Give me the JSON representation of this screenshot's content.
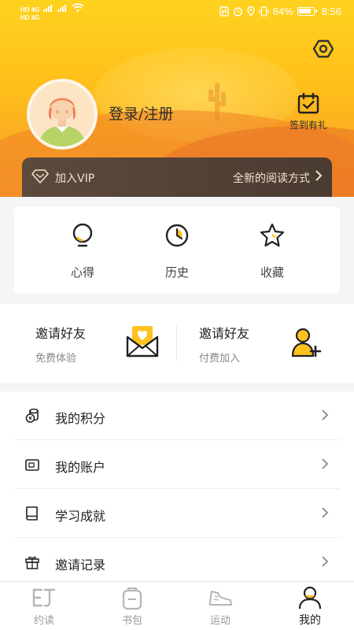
{
  "status_bar": {
    "left_top": "HD 4G",
    "left_bottom": "HD 4G",
    "battery": "84%",
    "time": "8:56"
  },
  "profile": {
    "login_label": "登录/注册",
    "checkin_label": "签到有礼"
  },
  "vip": {
    "join_label": "加入VIP",
    "tagline": "全新的阅读方式"
  },
  "quick_actions": [
    {
      "label": "心得",
      "icon": "lightbulb-icon"
    },
    {
      "label": "历史",
      "icon": "clock-icon"
    },
    {
      "label": "收藏",
      "icon": "star-icon"
    }
  ],
  "invite": {
    "free": {
      "title": "邀请好友",
      "subtitle": "免费体验"
    },
    "paid": {
      "title": "邀请好友",
      "subtitle": "付费加入"
    }
  },
  "menu": [
    {
      "label": "我的积分",
      "icon": "coins-icon"
    },
    {
      "label": "我的账户",
      "icon": "wallet-icon"
    },
    {
      "label": "学习成就",
      "icon": "book-icon"
    },
    {
      "label": "邀请记录",
      "icon": "gift-icon"
    }
  ],
  "tabs": [
    {
      "label": "约读",
      "active": false
    },
    {
      "label": "书包",
      "active": false
    },
    {
      "label": "运动",
      "active": false
    },
    {
      "label": "我的",
      "active": true
    }
  ],
  "colors": {
    "accent": "#ffc21f",
    "vip_bar": "#4f3f34",
    "vip_text": "#f1e4cf"
  }
}
